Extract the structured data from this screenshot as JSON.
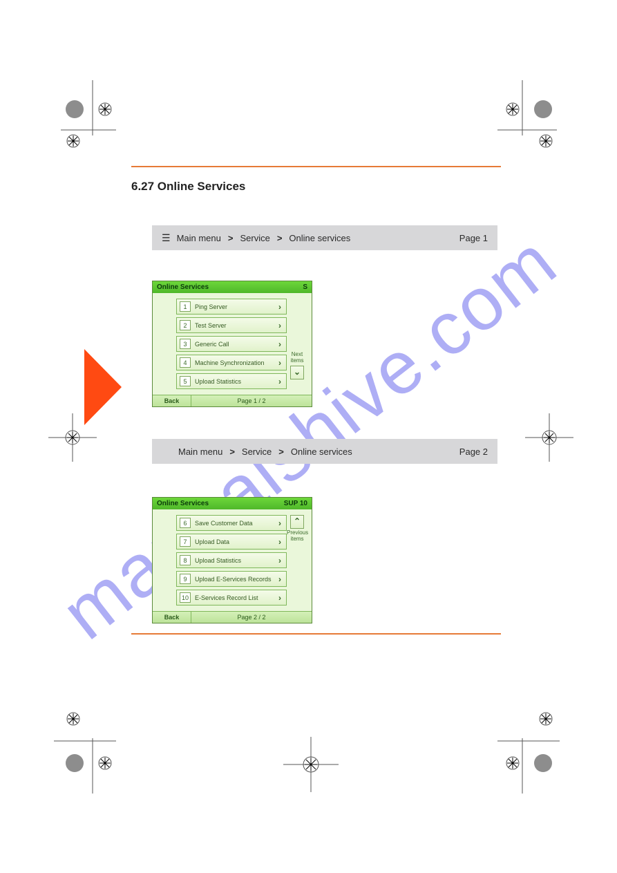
{
  "watermark": "manualshive.com",
  "section_title": "6.27 Online Services",
  "path1": {
    "icon": "menu-icon",
    "steps": [
      "Main menu",
      "Service",
      "Online services"
    ],
    "page_text": "Page 1"
  },
  "path2": {
    "steps": [
      "Main menu",
      "Service",
      "Online services"
    ],
    "page_text": "Page 2"
  },
  "screenshot1": {
    "title_left": "Online Services",
    "title_right": "S",
    "rows": [
      {
        "n": "1",
        "label": "Ping Server"
      },
      {
        "n": "2",
        "label": "Test Server"
      },
      {
        "n": "3",
        "label": "Generic Call"
      },
      {
        "n": "4",
        "label": "Machine Synchronization"
      },
      {
        "n": "5",
        "label": "Upload Statistics"
      }
    ],
    "pager": {
      "label": "Next items",
      "direction": "down"
    },
    "back": "Back",
    "page": "Page  1 / 2"
  },
  "screenshot2": {
    "title_left": "Online Services",
    "title_right": "SUP 10",
    "rows": [
      {
        "n": "6",
        "label": "Save Customer Data"
      },
      {
        "n": "7",
        "label": "Upload Data"
      },
      {
        "n": "8",
        "label": "Upload Statistics"
      },
      {
        "n": "9",
        "label": "Upload E-Services Records"
      },
      {
        "n": "10",
        "label": "E-Services Record List"
      }
    ],
    "pager": {
      "label": "Previous items",
      "direction": "up"
    },
    "back": "Back",
    "page": "Page  2 / 2"
  }
}
